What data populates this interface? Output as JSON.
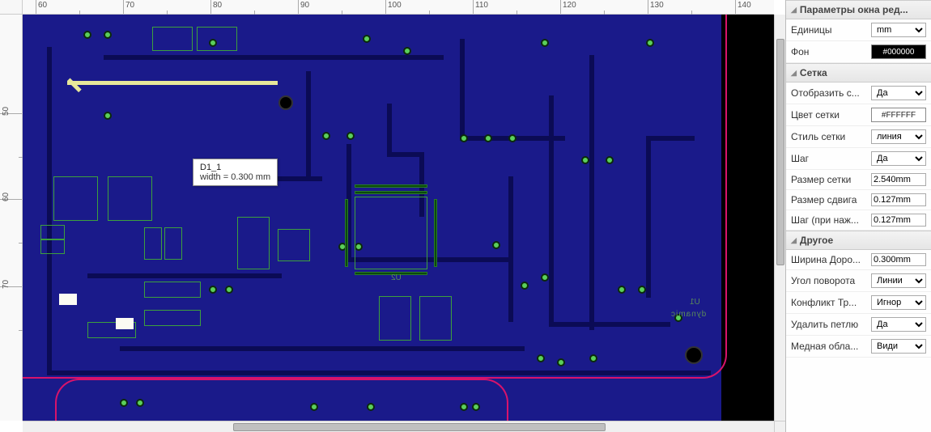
{
  "ruler_top": [
    "60",
    "70",
    "80",
    "90",
    "100",
    "110",
    "120",
    "130",
    "140"
  ],
  "ruler_left": [
    "50",
    "60",
    "70"
  ],
  "tooltip": {
    "line1": "D1_1",
    "line2": "width = 0.300 mm"
  },
  "canvas_labels": {
    "u1": "U1",
    "dynamic": "dynamic",
    "u2": "U2"
  },
  "panel": {
    "section1": {
      "title": "Параметры окна ред...",
      "units_label": "Единицы",
      "units_value": "mm",
      "bg_label": "Фон",
      "bg_value": "#000000"
    },
    "section2": {
      "title": "Сетка",
      "show_label": "Отобразить с...",
      "show_value": "Да",
      "color_label": "Цвет сетки",
      "color_value": "#FFFFFF",
      "style_label": "Стиль сетки",
      "style_value": "линия",
      "snap_label": "Шаг",
      "snap_value": "Да",
      "size_label": "Размер сетки",
      "size_value": "2.540mm",
      "shift_label": "Размер сдвига",
      "shift_value": "0.127mm",
      "shiftkey_label": "Шаг (при наж...",
      "shiftkey_value": "0.127mm"
    },
    "section3": {
      "title": "Другое",
      "trackwidth_label": "Ширина Доро...",
      "trackwidth_value": "0.300mm",
      "angle_label": "Угол поворота",
      "angle_value": "Линии",
      "conflict_label": "Конфликт Тр...",
      "conflict_value": "Игнор",
      "loop_label": "Удалить петлю",
      "loop_value": "Да",
      "copper_label": "Медная обла...",
      "copper_value": "Види"
    }
  }
}
